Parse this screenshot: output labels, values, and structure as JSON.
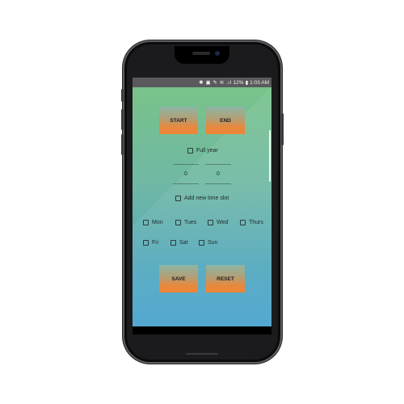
{
  "status_bar": {
    "icons_text": "✱ ▣ ✎ ≋ .ıl",
    "battery": "12%",
    "time": "1:03 AM"
  },
  "buttons": {
    "start": "START",
    "end": "END",
    "save": "SAVE",
    "reset": "RESET"
  },
  "full_year": {
    "label": "Full year",
    "checked": false
  },
  "time_fields": {
    "start_value": "0",
    "end_value": "0"
  },
  "add_slot": {
    "label": "Add new time slot",
    "checked": false
  },
  "days": [
    {
      "label": "Mon",
      "checked": false
    },
    {
      "label": "Tues",
      "checked": false
    },
    {
      "label": "Wed",
      "checked": false
    },
    {
      "label": "Thurs",
      "checked": false
    },
    {
      "label": "Fri",
      "checked": false
    },
    {
      "label": "Sat",
      "checked": false
    },
    {
      "label": "Sun",
      "checked": false
    }
  ],
  "colors": {
    "screen_top": "#79c487",
    "screen_bottom": "#46a2cf",
    "button_orange": "#ee8636"
  }
}
